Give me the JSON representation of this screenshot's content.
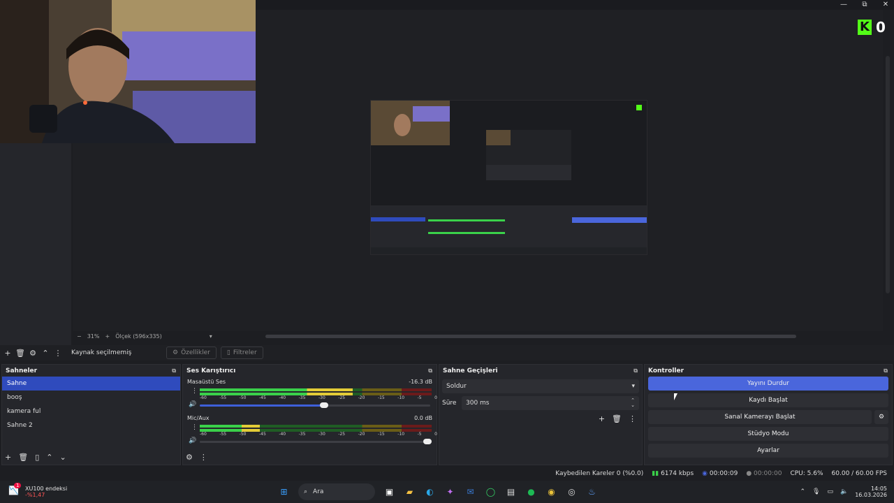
{
  "window": {
    "minimize": "—",
    "maximize": "⧉",
    "close": "✕"
  },
  "kick": {
    "logo_letter": "K",
    "viewer_count": "0"
  },
  "zoom": {
    "minus": "−",
    "percent": "31%",
    "plus": "+",
    "scale_label": "Ölçek (596x335)"
  },
  "source_bar": {
    "no_source": "Kaynak seçilmemiş",
    "properties": "Özellikler",
    "filters": "Filtreler"
  },
  "scenes": {
    "title": "Sahneler",
    "items": [
      "Sahne",
      "booş",
      "kamera ful",
      "Sahne 2"
    ],
    "selected": "Sahne"
  },
  "mixer": {
    "title": "Ses Karıştırıcı",
    "ticks": [
      "-60",
      "-55",
      "-50",
      "-45",
      "-40",
      "-35",
      "-30",
      "-25",
      "-20",
      "-15",
      "-10",
      "-5",
      "0"
    ],
    "tracks": [
      {
        "name": "Masaüstü Ses",
        "db": "-16.3 dB",
        "level": 0.66,
        "volume": 0.55
      },
      {
        "name": "Mic/Aux",
        "db": "0.0 dB",
        "level": 0.26,
        "volume": 1.0
      }
    ]
  },
  "transitions": {
    "title": "Sahne Geçişleri",
    "type": "Soldur",
    "duration_label": "Süre",
    "duration_value": "300 ms"
  },
  "controls": {
    "title": "Kontroller",
    "stop_stream": "Yayını Durdur",
    "start_recording": "Kaydı Başlat",
    "start_virtual_cam": "Sanal Kamerayı Başlat",
    "studio_mode": "Stüdyo Modu",
    "settings": "Ayarlar"
  },
  "status": {
    "dropped_frames": "Kaybedilen Kareler 0 (%0.0)",
    "bitrate": "6174 kbps",
    "stream_time": "00:00:09",
    "rec_time": "00:00:00",
    "cpu": "CPU: 5.6%",
    "fps": "60.00 / 60.00 FPS"
  },
  "taskbar": {
    "stock_name": "XU100 endeksi",
    "stock_change": "-%1,47",
    "stock_badge": "1",
    "search_placeholder": "Ara",
    "time": "14:05",
    "date": "16.03.2026"
  },
  "colors": {
    "accent": "#4a66dc",
    "scene_selected": "#2f4bbd",
    "kick_green": "#53fc18"
  }
}
